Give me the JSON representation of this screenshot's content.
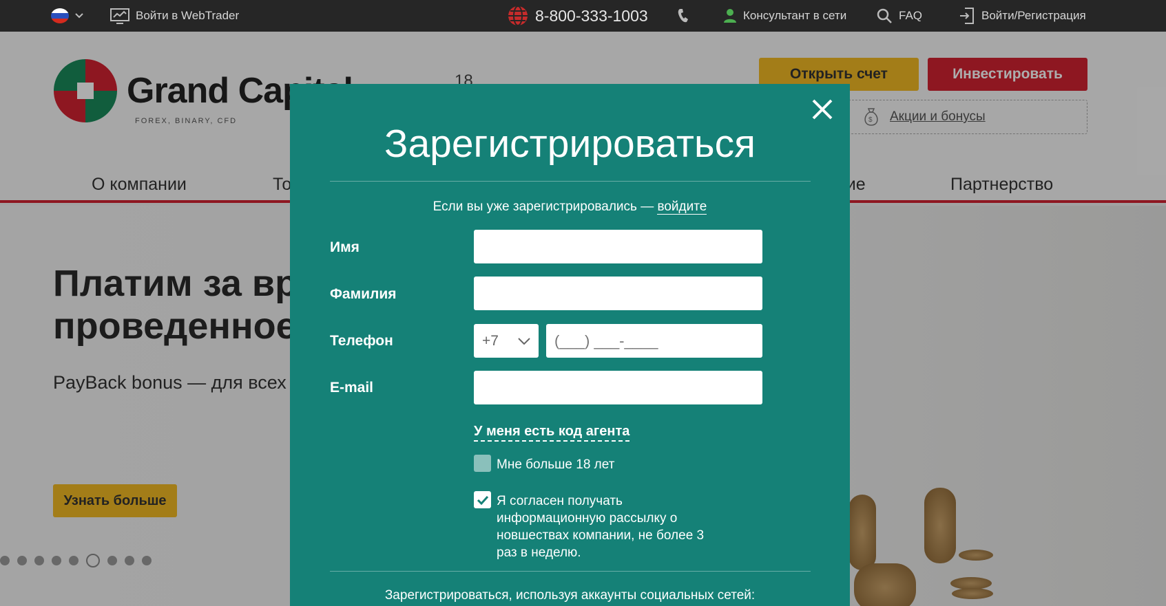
{
  "topbar": {
    "language": "RU",
    "webtrader": "Войти в WebTrader",
    "phone": "8-800-333-1003",
    "consultant": "Консультант в сети",
    "faq": "FAQ",
    "login": "Войти/Регистрация"
  },
  "header": {
    "logo_word": "Grand Capital",
    "logo_sub": "FOREX, BINARY, CFD",
    "age": "18",
    "open_account": "Открыть счет",
    "invest": "Инвестировать",
    "promo": "Акции и бонусы"
  },
  "nav": {
    "items": [
      "О компании",
      "То",
      "ние",
      "Партнерство"
    ]
  },
  "hero": {
    "title": "Платим за вр\nпроведенное",
    "subtitle": "PayBack bonus — для всех",
    "button": "Узнать больше",
    "slides_count": 9,
    "active_slide": 6
  },
  "modal": {
    "title": "Зарегистрироваться",
    "login_prompt": "Если вы уже зарегистрировались — ",
    "login_link": "войдите",
    "fields": {
      "first_name": {
        "label": "Имя",
        "value": ""
      },
      "last_name": {
        "label": "Фамилия",
        "value": ""
      },
      "phone": {
        "label": "Телефон",
        "code": "+7",
        "mask": "(___) ___-____"
      },
      "email": {
        "label": "E-mail",
        "value": ""
      }
    },
    "agent_code": "У меня есть код агента",
    "age_check": {
      "label": "Мне больше 18 лет",
      "checked": false
    },
    "newsletter": {
      "label": "Я согласен получать информационную рассылку о новшествах компании, не более 3 раз в неделю.",
      "checked": true
    },
    "social_text": "Зарегистрироваться, используя аккаунты социальных сетей:"
  },
  "colors": {
    "modal_bg": "#158177",
    "accent_yellow": "#f0b824",
    "accent_red": "#d22232",
    "topbar_bg": "#262626"
  }
}
